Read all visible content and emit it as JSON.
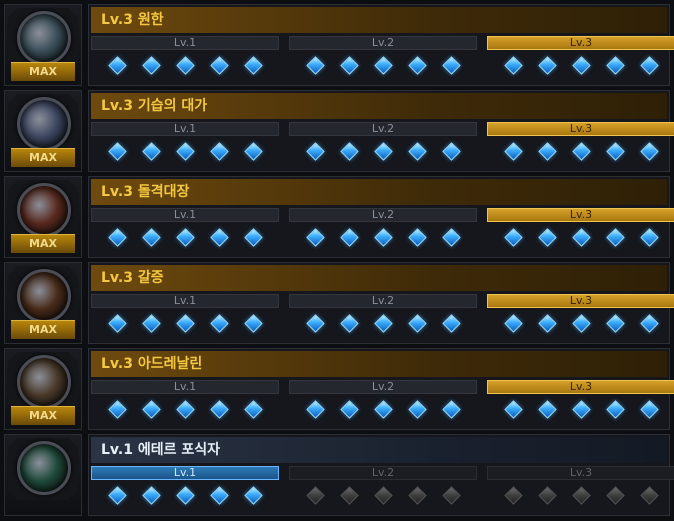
{
  "max_label": "MAX",
  "level_labels": [
    "Lv.1",
    "Lv.2",
    "Lv.3"
  ],
  "rows": [
    {
      "title": "Lv.3 원한",
      "maxed": true,
      "orb_color": "#3a4e58"
    },
    {
      "title": "Lv.3 기습의 대가",
      "maxed": true,
      "orb_color": "#3c4660"
    },
    {
      "title": "Lv.3 돌격대장",
      "maxed": true,
      "orb_color": "#5a2a1e"
    },
    {
      "title": "Lv.3 갈증",
      "maxed": true,
      "orb_color": "#4a2c1a"
    },
    {
      "title": "Lv.3 아드레날린",
      "maxed": true,
      "orb_color": "#4a3a2a"
    },
    {
      "title": "Lv.1 에테르 포식자",
      "maxed": false,
      "orb_color": "#1f4a3a"
    }
  ],
  "row_levels": [
    3,
    3,
    3,
    3,
    3,
    1
  ],
  "colors": {
    "gold": "#f5c842",
    "blue_gem": "#3fb0ff"
  }
}
